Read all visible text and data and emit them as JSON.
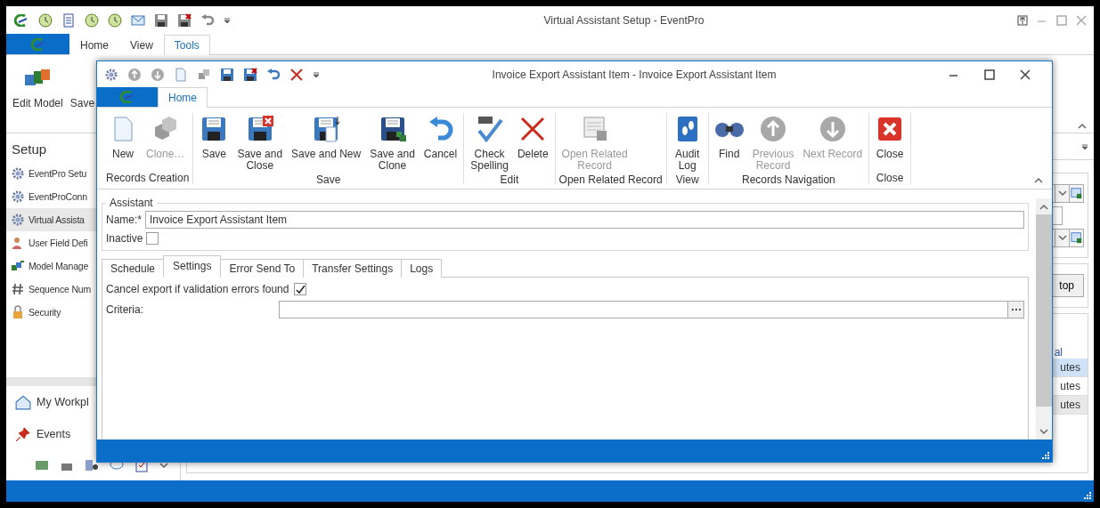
{
  "main_window": {
    "title": "Virtual Assistant Setup - EventPro",
    "tabs": [
      {
        "label": "Home",
        "selected": false
      },
      {
        "label": "View",
        "selected": false
      },
      {
        "label": "Tools",
        "selected": true
      }
    ],
    "ribbon_buttons": [
      "Edit Model",
      "Save"
    ],
    "sidebar": {
      "title": "Setup",
      "items": [
        {
          "label": "EventPro Setu",
          "selected": false
        },
        {
          "label": "EventProConn",
          "selected": false
        },
        {
          "label": "Virtual Assista",
          "selected": true
        },
        {
          "label": "User Field Defi",
          "selected": false
        },
        {
          "label": "Model Manage",
          "selected": false
        },
        {
          "label": "Sequence Num",
          "selected": false
        },
        {
          "label": "Security",
          "selected": false
        }
      ]
    },
    "navigation": [
      "My Workpl",
      "Events"
    ],
    "content": {
      "button": "top",
      "link": "al",
      "rows": [
        {
          "text": "utes",
          "selected": true
        },
        {
          "text": "utes",
          "selected": false
        },
        {
          "text": "utes",
          "selected": false
        }
      ]
    }
  },
  "dialog": {
    "title": "Invoice Export Assistant Item - Invoice Export Assistant Item",
    "tabs": [
      {
        "label": "Home",
        "selected": true
      }
    ],
    "groups": [
      {
        "label": "Records Creation",
        "buttons": [
          {
            "label": "New",
            "disabled": false
          },
          {
            "label": "Clone…",
            "disabled": true
          }
        ]
      },
      {
        "label": "Save",
        "buttons": [
          {
            "label": "Save",
            "disabled": false
          },
          {
            "label": "Save and\nClose",
            "disabled": false
          },
          {
            "label": "Save and New",
            "disabled": false
          },
          {
            "label": "Save and\nClone",
            "disabled": false
          },
          {
            "label": "Cancel",
            "disabled": false
          }
        ]
      },
      {
        "label": "Edit",
        "buttons": [
          {
            "label": "Check\nSpelling",
            "disabled": false
          },
          {
            "label": "Delete",
            "disabled": false
          }
        ]
      },
      {
        "label": "Open Related Record",
        "buttons": [
          {
            "label": "Open Related\nRecord",
            "disabled": true
          }
        ]
      },
      {
        "label": "View",
        "buttons": [
          {
            "label": "Audit\nLog",
            "disabled": false
          }
        ]
      },
      {
        "label": "Records Navigation",
        "buttons": [
          {
            "label": "Find",
            "disabled": false
          },
          {
            "label": "Previous\nRecord",
            "disabled": true
          },
          {
            "label": "Next Record",
            "disabled": true
          }
        ]
      },
      {
        "label": "Close",
        "buttons": [
          {
            "label": "Close",
            "disabled": false
          }
        ]
      }
    ],
    "assistant": {
      "legend": "Assistant",
      "name_label": "Name:*",
      "name_value": "Invoice Export Assistant Item",
      "inactive_label": "Inactive",
      "inactive_checked": false
    },
    "form_tabs": [
      {
        "label": "Schedule",
        "selected": false
      },
      {
        "label": "Settings",
        "selected": true
      },
      {
        "label": "Error Send To",
        "selected": false
      },
      {
        "label": "Transfer Settings",
        "selected": false
      },
      {
        "label": "Logs",
        "selected": false
      }
    ],
    "settings": {
      "cancel_label": "Cancel export if validation errors found",
      "cancel_checked": true,
      "criteria_label": "Criteria:"
    }
  }
}
